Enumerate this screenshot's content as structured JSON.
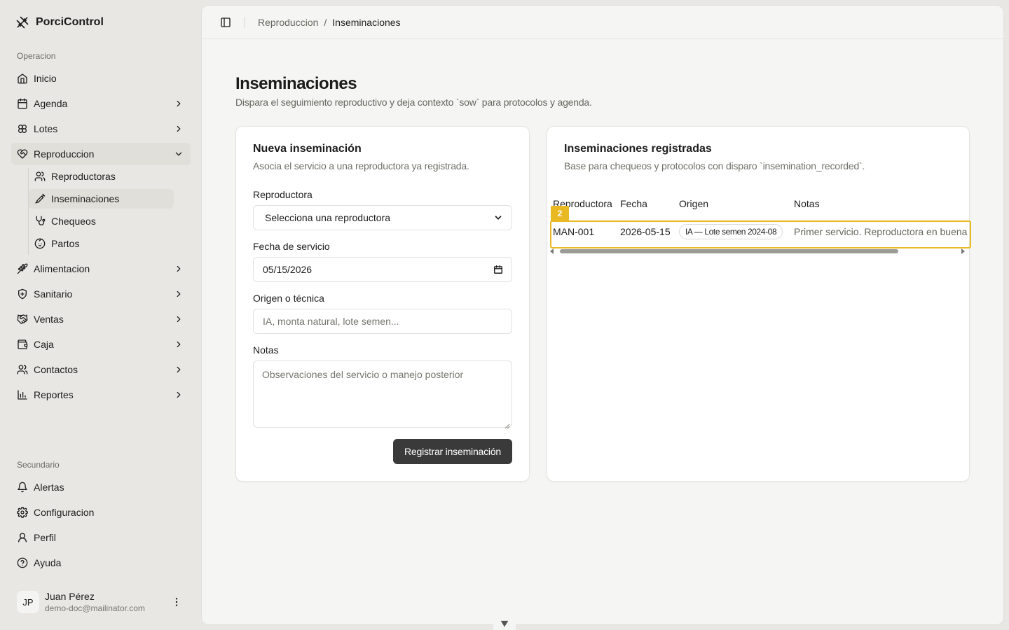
{
  "app": {
    "name": "PorciControl"
  },
  "sidebar": {
    "group_primary": "Operacion",
    "group_secondary": "Secundario",
    "items": [
      {
        "label": "Inicio"
      },
      {
        "label": "Agenda"
      },
      {
        "label": "Lotes"
      },
      {
        "label": "Reproduccion"
      },
      {
        "label": "Alimentacion"
      },
      {
        "label": "Sanitario"
      },
      {
        "label": "Ventas"
      },
      {
        "label": "Caja"
      },
      {
        "label": "Contactos"
      },
      {
        "label": "Reportes"
      }
    ],
    "sub_items": [
      {
        "label": "Reproductoras"
      },
      {
        "label": "Inseminaciones"
      },
      {
        "label": "Chequeos"
      },
      {
        "label": "Partos"
      }
    ],
    "secondary_items": [
      {
        "label": "Alertas"
      },
      {
        "label": "Configuracion"
      },
      {
        "label": "Perfil"
      },
      {
        "label": "Ayuda"
      }
    ],
    "user": {
      "initials": "JP",
      "name": "Juan Pérez",
      "email": "demo-doc@mailinator.com"
    }
  },
  "breadcrumb": {
    "parent": "Reproduccion",
    "separator": "/",
    "current": "Inseminaciones"
  },
  "page": {
    "title": "Inseminaciones",
    "subtitle": "Dispara el seguimiento reproductivo y deja contexto `sow` para protocolos y agenda."
  },
  "form": {
    "title": "Nueva inseminación",
    "description": "Asocia el servicio a una reproductora ya registrada.",
    "sow_label": "Reproductora",
    "sow_value": "Selecciona una reproductora",
    "date_label": "Fecha de servicio",
    "date_value": "05/15/2026",
    "origin_label": "Origen o técnica",
    "origin_placeholder": "IA, monta natural, lote semen...",
    "notes_label": "Notas",
    "notes_placeholder": "Observaciones del servicio o manejo posterior",
    "submit_label": "Registrar inseminación"
  },
  "records": {
    "title": "Inseminaciones registradas",
    "description": "Base para chequeos y protocolos con disparo `insemination_recorded`.",
    "columns": [
      "Reproductora",
      "Fecha",
      "Origen",
      "Notas"
    ],
    "rows": [
      {
        "sow": "MAN-001",
        "date": "2026-05-15",
        "origin": "IA — Lote semen 2024-08",
        "notes": "Primer servicio. Reproductora en buena condición"
      }
    ],
    "highlight_tag": "2"
  },
  "colors": {
    "accent": "#e8b923",
    "button": "#3a3a3a",
    "sidebar_bg": "#e8e7e3"
  }
}
